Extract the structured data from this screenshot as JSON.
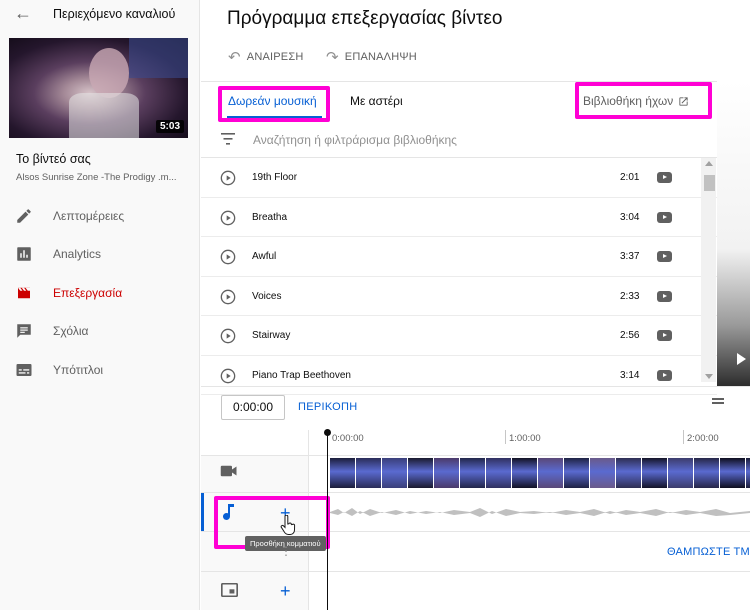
{
  "sidebar": {
    "back_label": "Περιεχόμενο καναλιού",
    "video_duration": "5:03",
    "video_title": "Το βίντεό σας",
    "video_subtitle": "Alsos Sunrise Zone -The Prodigy .m...",
    "items": [
      {
        "label": "Λεπτομέρειες",
        "icon": "pencil-icon"
      },
      {
        "label": "Analytics",
        "icon": "analytics-icon"
      },
      {
        "label": "Επεξεργασία",
        "icon": "editor-icon",
        "active": true
      },
      {
        "label": "Σχόλια",
        "icon": "comments-icon"
      },
      {
        "label": "Υπότιτλοι",
        "icon": "subtitles-icon"
      }
    ]
  },
  "header": {
    "title": "Πρόγραμμα επεξεργασίας βίντεο",
    "undo": "ΑΝΑΙΡΕΣΗ",
    "redo": "ΕΠΑΝΑΛΗΨΗ"
  },
  "library": {
    "tab_free": "Δωρεάν μουσική",
    "tab_starred": "Με αστέρι",
    "audio_library": "Βιβλιοθήκη ήχων",
    "search_placeholder": "Αναζήτηση ή φιλτράρισμα βιβλιοθήκης",
    "tracks": [
      {
        "name": "19th Floor",
        "duration": "2:01"
      },
      {
        "name": "Breatha",
        "duration": "3:04"
      },
      {
        "name": "Awful",
        "duration": "3:37"
      },
      {
        "name": "Voices",
        "duration": "2:33"
      },
      {
        "name": "Stairway",
        "duration": "2:56"
      },
      {
        "name": "Piano Trap Beethoven",
        "duration": "3:14"
      }
    ]
  },
  "timeline": {
    "time_value": "0:00:00",
    "trim_label": "ΠΕΡΙΚΟΠΗ",
    "ruler": [
      "0:00:00",
      "1:00:00",
      "2:00:00"
    ],
    "add_track_tooltip": "Προσθήκη κομματιού",
    "blur_label": "ΘΑΜΠΩΣΤΕ ΤΜΗ"
  },
  "colors": {
    "accent": "#065fd4",
    "active_red": "#cc0000",
    "highlight": "#ff00d4"
  }
}
